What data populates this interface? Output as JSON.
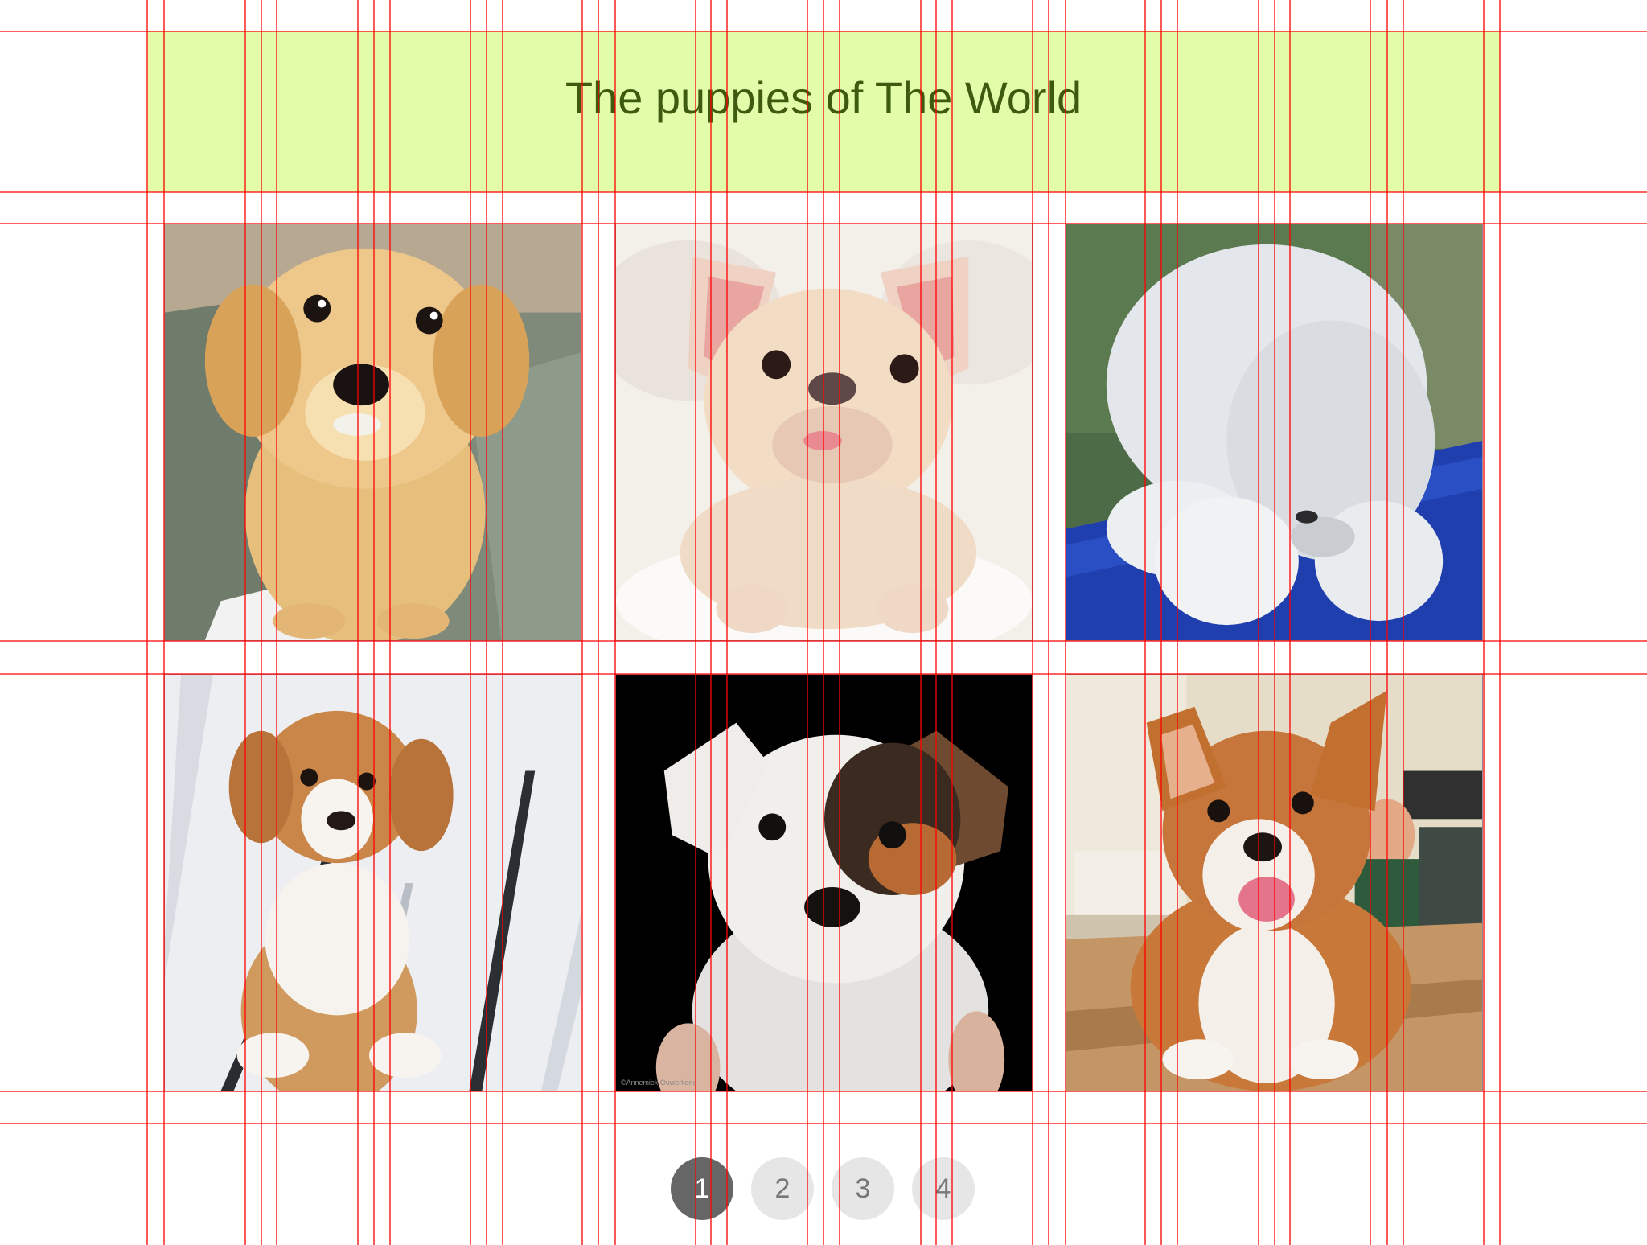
{
  "header": {
    "title": "The puppies of The World",
    "background": "#e2fca9",
    "text_color": "#3d5a0f"
  },
  "gallery": {
    "tiles": [
      {
        "subject": "golden puppy on carpet",
        "background": "#8d9a8c",
        "fur": "#e9c07c"
      },
      {
        "subject": "cream french bulldog puppy on white bed",
        "background": "#f1ece6",
        "fur": "#f0dcc6"
      },
      {
        "subject": "white fluffy puppy on blue towel",
        "background": "#3b5a3a",
        "fur": "#e8ebee"
      },
      {
        "subject": "brown and white puppy on white deck",
        "background": "#e8eaee",
        "fur": "#c58a4d"
      },
      {
        "subject": "white puppy with brown ear patch on black",
        "background": "#000000",
        "fur": "#f0eeeb"
      },
      {
        "subject": "corgi puppy on kitchen floor",
        "background": "#c9a57c",
        "fur": "#c97a3c"
      }
    ],
    "caption_small": "©Annemiek Ouwerkerk"
  },
  "pagination": {
    "pages": [
      "1",
      "2",
      "3",
      "4"
    ],
    "current": "1",
    "active_color": "#666666",
    "inactive_color": "#e6e6e6"
  },
  "guides": {
    "color": "#ff0000"
  }
}
